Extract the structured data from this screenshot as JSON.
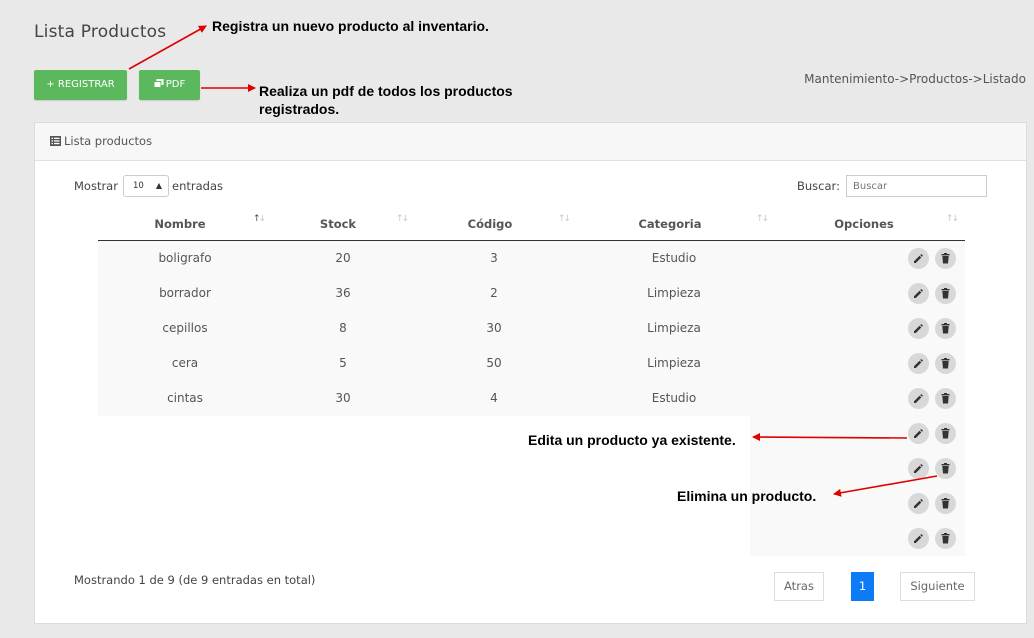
{
  "page": {
    "title": "Lista Productos",
    "breadcrumb": "Mantenimiento->Productos->Listado"
  },
  "toolbar": {
    "register_label": "+ REGISTRAR",
    "pdf_label": "PDF",
    "pdf_icon": "copy-icon"
  },
  "colors": {
    "accent": "#5cb85c",
    "active_page": "#0d7bf5",
    "annotation_arrow": "#e00000"
  },
  "annotations": {
    "register": "Registra un nuevo producto al inventario.",
    "pdf_line1": "Realiza un pdf de todos los productos",
    "pdf_line2": "registrados.",
    "edit": "Edita un producto ya existente.",
    "delete": "Elimina un producto."
  },
  "card": {
    "title": "Lista productos",
    "icon": "list-icon"
  },
  "table_controls": {
    "show_label": "Mostrar",
    "page_size": "10",
    "entries_label": "entradas",
    "search_label": "Buscar:",
    "search_placeholder": "Buscar"
  },
  "table": {
    "columns": [
      "Nombre",
      "Stock",
      "Código",
      "Categoria",
      "Opciones"
    ],
    "rows": [
      {
        "nombre": "boligrafo",
        "stock": "20",
        "codigo": "3",
        "categoria": "Estudio"
      },
      {
        "nombre": "borrador",
        "stock": "36",
        "codigo": "2",
        "categoria": "Limpieza"
      },
      {
        "nombre": "cepillos",
        "stock": "8",
        "codigo": "30",
        "categoria": "Limpieza"
      },
      {
        "nombre": "cera",
        "stock": "5",
        "codigo": "50",
        "categoria": "Limpieza"
      },
      {
        "nombre": "cintas",
        "stock": "30",
        "codigo": "4",
        "categoria": "Estudio"
      }
    ],
    "row_action_icons": [
      "pencil-icon",
      "trash-icon"
    ]
  },
  "footer": {
    "info": "Mostrando 1 de 9 (de 9 entradas en total)",
    "prev_label": "Atras",
    "page": "1",
    "next_label": "Siguiente"
  }
}
